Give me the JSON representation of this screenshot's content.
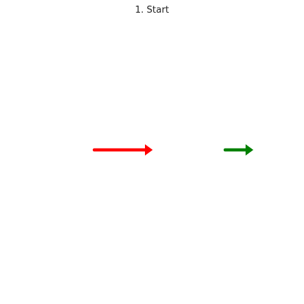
{
  "diagram": {
    "title": "1. Start",
    "arrows": [
      {
        "name": "red-arrow",
        "color": "#ff0000",
        "direction": "right"
      },
      {
        "name": "green-arrow",
        "color": "#008000",
        "direction": "right"
      }
    ]
  }
}
